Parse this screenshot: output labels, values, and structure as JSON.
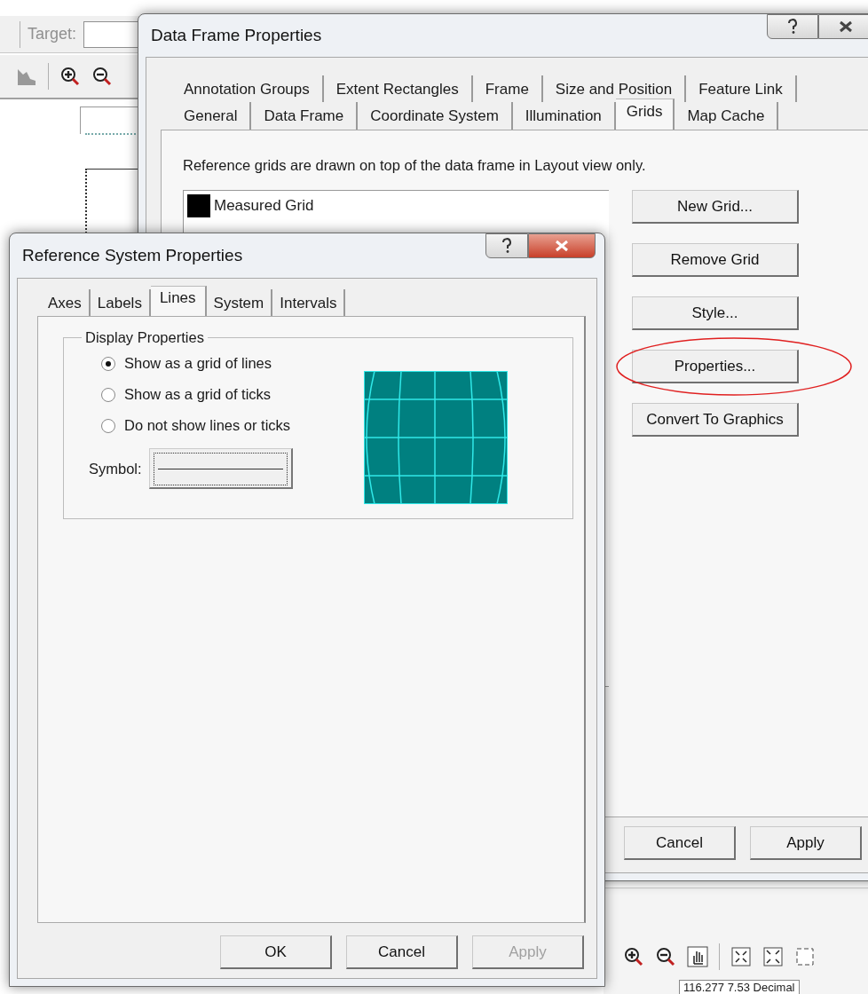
{
  "background_app": {
    "target_label": "Target:",
    "status_text": "116.277  7.53 Decimal"
  },
  "data_frame_dialog": {
    "title": "Data Frame Properties",
    "tab_rows": [
      [
        {
          "label": "Annotation Groups",
          "selected": false
        },
        {
          "label": "Extent Rectangles",
          "selected": false
        },
        {
          "label": "Frame",
          "selected": false
        },
        {
          "label": "Size and Position",
          "selected": false
        },
        {
          "label": "Feature Link",
          "selected": false
        }
      ],
      [
        {
          "label": "General",
          "selected": false
        },
        {
          "label": "Data Frame",
          "selected": false
        },
        {
          "label": "Coordinate System",
          "selected": false
        },
        {
          "label": "Illumination",
          "selected": false
        },
        {
          "label": "Grids",
          "selected": true
        },
        {
          "label": "Map Cache",
          "selected": false
        }
      ]
    ],
    "description": "Reference grids are drawn on top of the data frame in Layout view only.",
    "grids": [
      {
        "name": "Measured Grid"
      }
    ],
    "buttons": [
      {
        "label": "New Grid...",
        "highlighted": false
      },
      {
        "label": "Remove Grid",
        "highlighted": false
      },
      {
        "label": "Style...",
        "highlighted": false
      },
      {
        "label": "Properties...",
        "highlighted": true
      },
      {
        "label": "Convert To Graphics",
        "highlighted": false
      }
    ],
    "footer_buttons": [
      {
        "label": "Cancel",
        "disabled": false
      },
      {
        "label": "Apply",
        "disabled": false
      }
    ]
  },
  "reference_dialog": {
    "title": "Reference System Properties",
    "tabs": [
      {
        "label": "Axes",
        "selected": false
      },
      {
        "label": "Labels",
        "selected": false
      },
      {
        "label": "Lines",
        "selected": true
      },
      {
        "label": "System",
        "selected": false
      },
      {
        "label": "Intervals",
        "selected": false
      }
    ],
    "group_title": "Display Properties",
    "options": [
      {
        "label": "Show as a grid of lines",
        "selected": true
      },
      {
        "label": "Show as a grid of ticks",
        "selected": false
      },
      {
        "label": "Do not show lines or ticks",
        "selected": false
      }
    ],
    "symbol_label": "Symbol:",
    "footer_buttons": [
      {
        "label": "OK",
        "disabled": false
      },
      {
        "label": "Cancel",
        "disabled": false
      },
      {
        "label": "Apply",
        "disabled": true
      }
    ]
  }
}
